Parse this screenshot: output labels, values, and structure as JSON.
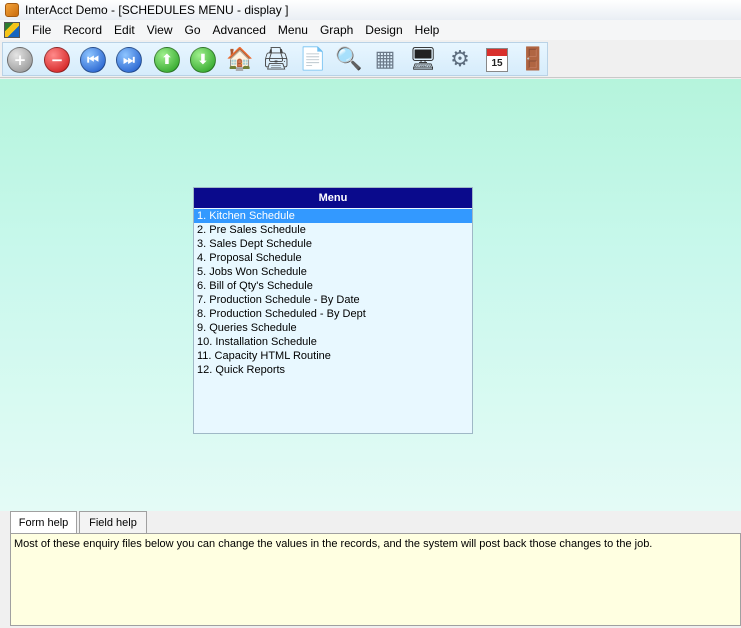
{
  "window": {
    "title": "InterAcct Demo - [SCHEDULES MENU - display ]"
  },
  "menubar": {
    "items": [
      "File",
      "Record",
      "Edit",
      "View",
      "Go",
      "Advanced",
      "Menu",
      "Graph",
      "Design",
      "Help"
    ]
  },
  "toolbar": {
    "buttons": [
      {
        "icon": "add-circle-icon",
        "glyph": "+"
      },
      {
        "icon": "remove-circle-icon",
        "glyph": "−"
      },
      {
        "icon": "first-record-icon",
        "glyph": "⏮"
      },
      {
        "icon": "last-record-icon",
        "glyph": "⏭"
      },
      {
        "icon": "move-up-icon",
        "glyph": "⬆"
      },
      {
        "icon": "move-down-icon",
        "glyph": "⬇"
      },
      {
        "icon": "home-icon",
        "glyph": "🏠"
      },
      {
        "icon": "printer-icon",
        "glyph": "🖨"
      },
      {
        "icon": "document-icon",
        "glyph": "📄"
      },
      {
        "icon": "magnifier-icon",
        "glyph": "🔍"
      },
      {
        "icon": "binary-data-icon",
        "glyph": "▦"
      },
      {
        "icon": "monitor-icon",
        "glyph": "🖥"
      },
      {
        "icon": "settings-gear-icon",
        "glyph": "⚙"
      },
      {
        "icon": "calendar-icon",
        "glyph": "15"
      },
      {
        "icon": "exit-door-icon",
        "glyph": "🚪"
      }
    ]
  },
  "menu_panel": {
    "header": "Menu",
    "selected_index": 0,
    "items": [
      "1. Kitchen Schedule",
      "2. Pre Sales Schedule",
      "3. Sales Dept Schedule",
      "4. Proposal Schedule",
      "5. Jobs Won Schedule",
      "6. Bill of Qty's Schedule",
      "7. Production Schedule - By Date",
      "8. Production Scheduled - By Dept",
      "9. Queries Schedule",
      "10. Installation Schedule",
      "11. Capacity HTML Routine",
      "12. Quick Reports"
    ]
  },
  "help": {
    "tabs": [
      "Form help",
      "Field help"
    ],
    "active_tab": 0,
    "text": "Most of these enquiry files below you can change the values in the records, and the system will post back those changes to the job."
  },
  "colors": {
    "menu_header": "#0a0a8c",
    "selected_item": "#3399ff",
    "background_top": "#b5f4dc",
    "help_background": "#ffffe1"
  }
}
